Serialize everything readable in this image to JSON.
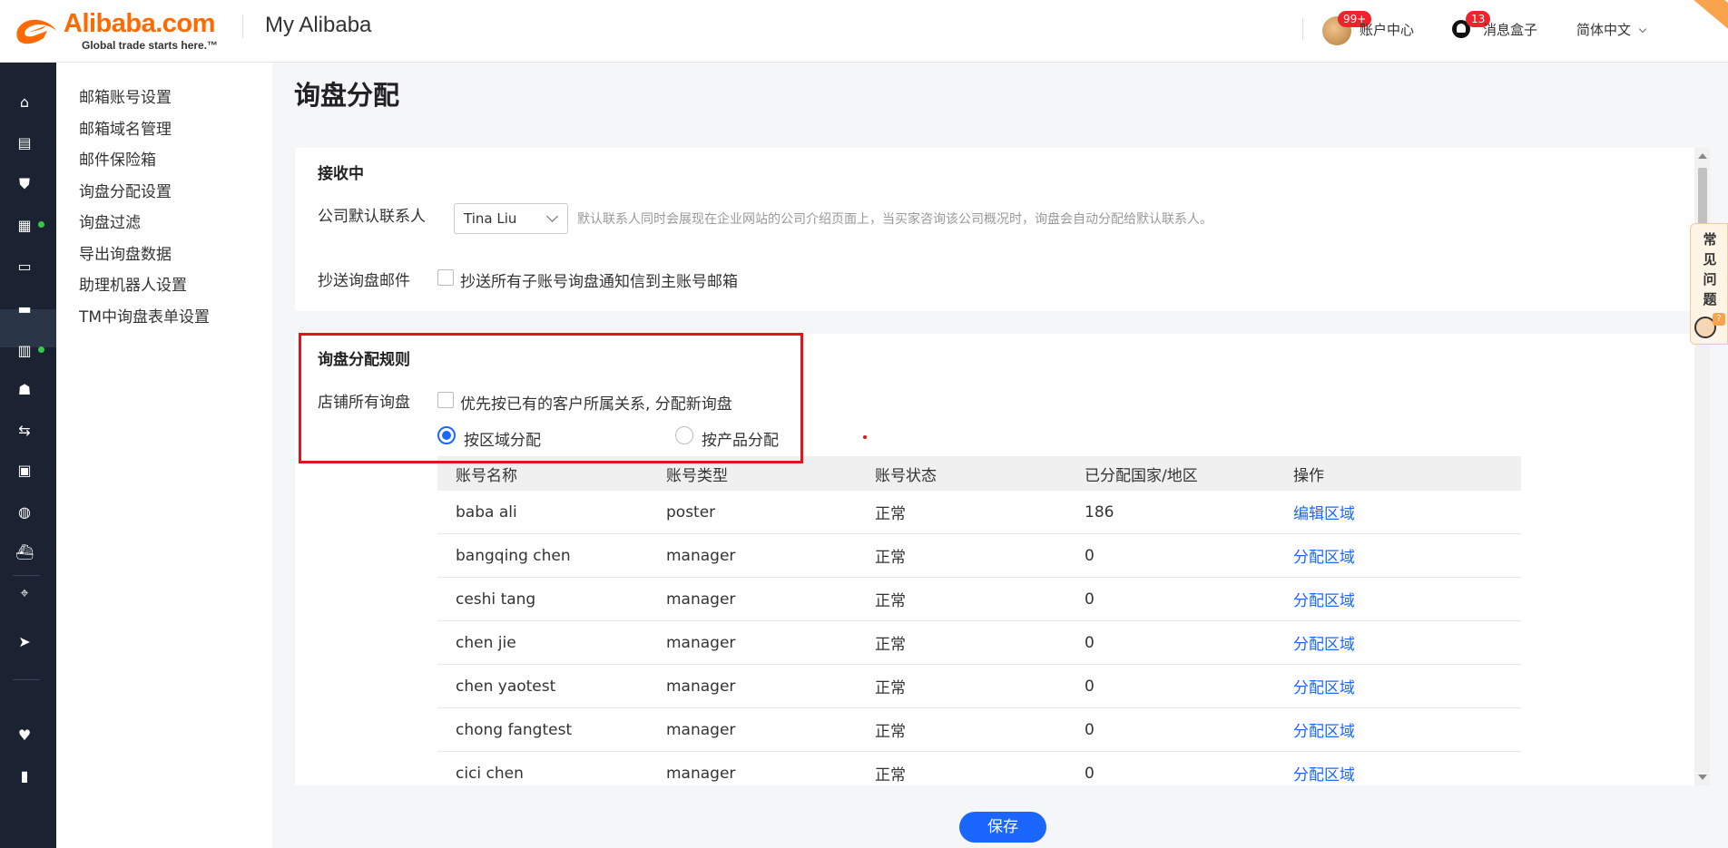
{
  "header": {
    "logo_text": "Alibaba.com",
    "logo_tagline": "Global trade starts here.™",
    "title": "My Alibaba",
    "account_badge": "99+",
    "account_label": "账户中心",
    "messages_badge": "13",
    "messages_label": "消息盒子",
    "language": "简体中文"
  },
  "sidebar": {
    "items": [
      {
        "label": "邮箱账号设置"
      },
      {
        "label": "邮箱域名管理"
      },
      {
        "label": "邮件保险箱"
      },
      {
        "label": "询盘分配设置"
      },
      {
        "label": "询盘过滤"
      },
      {
        "label": "导出询盘数据"
      },
      {
        "label": "助理机器人设置"
      },
      {
        "label": "TM中询盘表单设置"
      }
    ]
  },
  "page": {
    "title": "询盘分配"
  },
  "receiving": {
    "title": "接收中",
    "default_contact_label": "公司默认联系人",
    "default_contact_value": "Tina Liu",
    "default_contact_hint": "默认联系人同时会展现在企业网站的公司介绍页面上，当买家咨询该公司概况时，询盘会自动分配给默认联系人。",
    "cc_label": "抄送询盘邮件",
    "cc_option": "抄送所有子账号询盘通知信到主账号邮箱",
    "cc_checked": false
  },
  "rules": {
    "title": "询盘分配规则",
    "store_label": "店铺所有询盘",
    "priority_option": "优先按已有的客户所属关系, 分配新询盘",
    "priority_checked": false,
    "by_region": "按区域分配",
    "by_product": "按产品分配",
    "selected": "by_region"
  },
  "table": {
    "headers": [
      "账号名称",
      "账号类型",
      "账号状态",
      "已分配国家/地区",
      "操作"
    ],
    "rows": [
      {
        "name": "baba ali",
        "type": "poster",
        "status": "正常",
        "count": "186",
        "action": "编辑区域"
      },
      {
        "name": "bangqing chen",
        "type": "manager",
        "status": "正常",
        "count": "0",
        "action": "分配区域"
      },
      {
        "name": "ceshi tang",
        "type": "manager",
        "status": "正常",
        "count": "0",
        "action": "分配区域"
      },
      {
        "name": "chen jie",
        "type": "manager",
        "status": "正常",
        "count": "0",
        "action": "分配区域"
      },
      {
        "name": "chen yaotest",
        "type": "manager",
        "status": "正常",
        "count": "0",
        "action": "分配区域"
      },
      {
        "name": "chong fangtest",
        "type": "manager",
        "status": "正常",
        "count": "0",
        "action": "分配区域"
      },
      {
        "name": "cici chen",
        "type": "manager",
        "status": "正常",
        "count": "0",
        "action": "分配区域"
      }
    ]
  },
  "faq": {
    "label": "常见问题"
  },
  "save_label": "保存",
  "colors": {
    "brand": "#ff6a00",
    "primary": "#1a66ff",
    "highlight": "#e3141c",
    "rail": "#1b2332"
  }
}
